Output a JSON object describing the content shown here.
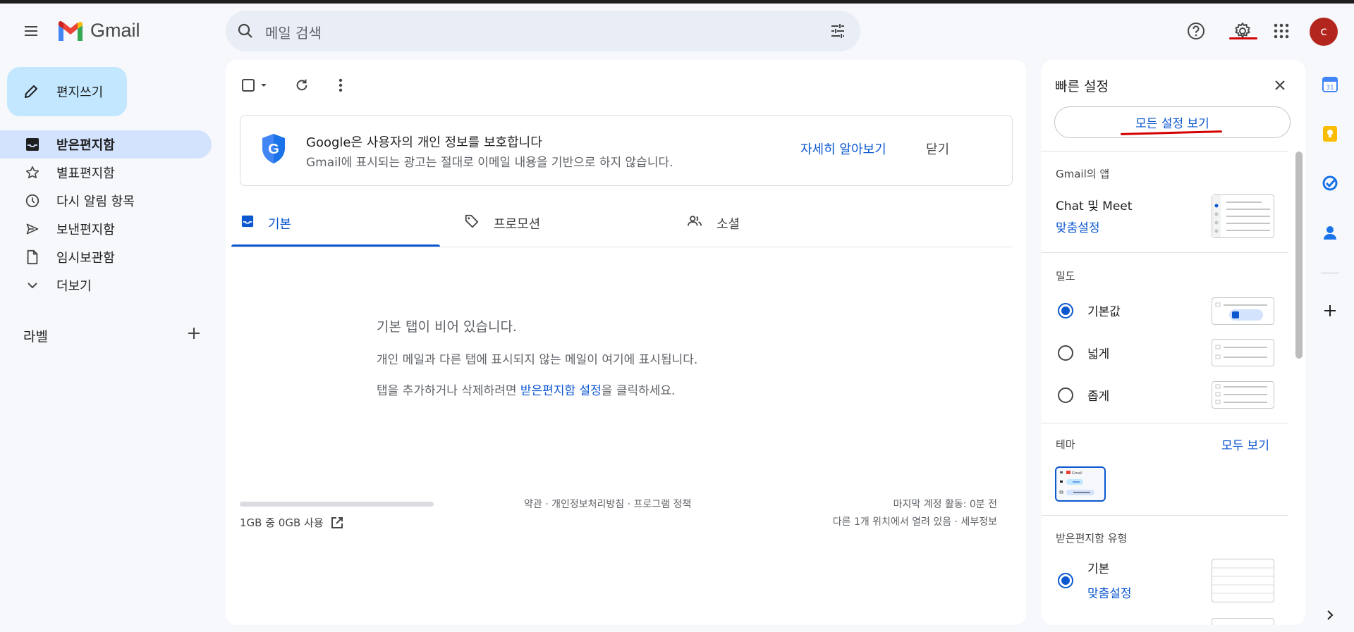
{
  "app": {
    "name": "Gmail",
    "avatar_initial": "c"
  },
  "search": {
    "placeholder": "메일 검색"
  },
  "sidebar": {
    "compose_label": "편지쓰기",
    "items": [
      {
        "label": "받은편지함",
        "icon": "inbox-icon",
        "active": true
      },
      {
        "label": "별표편지함",
        "icon": "star-icon"
      },
      {
        "label": "다시 알림 항목",
        "icon": "clock-icon"
      },
      {
        "label": "보낸편지함",
        "icon": "send-icon"
      },
      {
        "label": "임시보관함",
        "icon": "draft-icon"
      },
      {
        "label": "더보기",
        "icon": "chevron-down-icon"
      }
    ],
    "labels_title": "라벨"
  },
  "banner": {
    "title": "Google은 사용자의 개인 정보를 보호합니다",
    "subtitle": "Gmail에 표시되는 광고는 절대로 이메일 내용을 기반으로 하지 않습니다.",
    "learn_more": "자세히 알아보기",
    "close": "닫기"
  },
  "tabs": [
    {
      "label": "기본",
      "icon": "inbox-icon",
      "active": true
    },
    {
      "label": "프로모션",
      "icon": "tag-icon"
    },
    {
      "label": "소셜",
      "icon": "people-icon"
    }
  ],
  "empty": {
    "title": "기본 탭이 비어 있습니다.",
    "line1": "개인 메일과 다른 탭에 표시되지 않는 메일이 여기에 표시됩니다.",
    "line2_pre": "탭을 추가하거나 삭제하려면 ",
    "line2_link": "받은편지함 설정",
    "line2_post": "을 클릭하세요."
  },
  "footer": {
    "storage": "1GB 중 0GB 사용",
    "storage_used_fraction": 0.0,
    "links": "약관 · 개인정보처리방침 · 프로그램 정책",
    "last_activity": "마지막 계정 활동: 0분 전",
    "open_elsewhere": "다른 1개 위치에서 열려 있음 · 세부정보"
  },
  "quick_settings": {
    "title": "빠른 설정",
    "see_all": "모든 설정 보기",
    "apps_section": "Gmail의 앱",
    "chat_meet": "Chat 및 Meet",
    "customize": "맞춤설정",
    "density_section": "밀도",
    "density": [
      {
        "label": "기본값",
        "selected": true
      },
      {
        "label": "넓게",
        "selected": false
      },
      {
        "label": "좁게",
        "selected": false
      }
    ],
    "theme_section": "테마",
    "theme_view_all": "모두 보기",
    "theme_thumb_label": "Gmail",
    "inbox_type_section": "받은편지함 유형",
    "inbox_type": "기본",
    "inbox_type_customize": "맞춤설정"
  },
  "colors": {
    "accent": "#0b57d0",
    "compose_bg": "#c2e7ff",
    "active_nav": "#d3e3fd",
    "annotation_red": "#d40000",
    "avatar": "#b3261e"
  }
}
